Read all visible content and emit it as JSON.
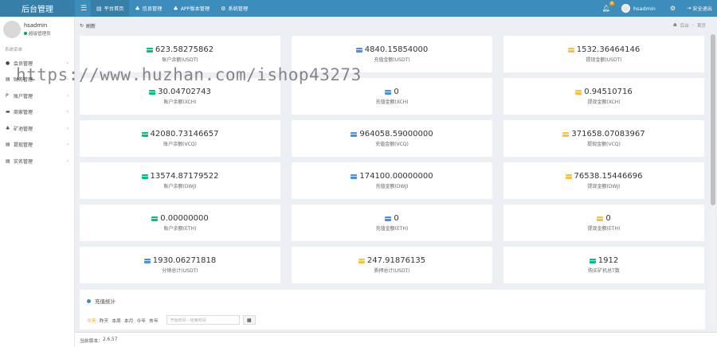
{
  "topbar": {
    "logo": "后台管理",
    "nav": [
      {
        "icon": "▤",
        "label": "平台首页",
        "active": true
      },
      {
        "icon": "♣",
        "label": "信息管理",
        "active": false
      },
      {
        "icon": "♣",
        "label": "APP版本管理",
        "active": false
      },
      {
        "icon": "⚙",
        "label": "系统管理",
        "active": false
      }
    ],
    "badge": "0",
    "username": "hsadmin",
    "logout": "安全退出"
  },
  "sidebar": {
    "username": "hsadmin",
    "role": "超级管理员",
    "header": "系统菜单",
    "items": [
      {
        "icon": "●",
        "label": "会员管理"
      },
      {
        "icon": "▤",
        "label": "财务管理"
      },
      {
        "icon": "P",
        "label": "账户管理"
      },
      {
        "icon": "▬",
        "label": "商家管理"
      },
      {
        "icon": "♣",
        "label": "矿池管理"
      },
      {
        "icon": "▤",
        "label": "提现管理"
      },
      {
        "icon": "▤",
        "label": "实名管理"
      }
    ]
  },
  "content_header": {
    "refresh": "刷新",
    "crumb_root": "后台",
    "crumb_current": "首页"
  },
  "cards": [
    {
      "value": "623.58275862",
      "label": "账户余额(USDT)",
      "color": "#00c27a"
    },
    {
      "value": "4840.15854000",
      "label": "充值金额(USDT)",
      "color": "#4a90e2"
    },
    {
      "value": "1532.36464146",
      "label": "提现金额(USDT)",
      "color": "#f5c242"
    },
    {
      "value": "30.04702743",
      "label": "账户余额(XCH)",
      "color": "#00c27a"
    },
    {
      "value": "0",
      "label": "充值金额(XCH)",
      "color": "#4a90e2"
    },
    {
      "value": "0.94510716",
      "label": "提现金额(XCH)",
      "color": "#f5c242"
    },
    {
      "value": "42080.73146657",
      "label": "账户余额(VCQ)",
      "color": "#00c27a"
    },
    {
      "value": "964058.59000000",
      "label": "充值金额(VCQ)",
      "color": "#4a90e2"
    },
    {
      "value": "371658.07083967",
      "label": "提现金额(VCQ)",
      "color": "#f5c242"
    },
    {
      "value": "13574.87179522",
      "label": "账户余额(DWJ)",
      "color": "#00c27a"
    },
    {
      "value": "174100.00000000",
      "label": "充值金额(DWJ)",
      "color": "#4a90e2"
    },
    {
      "value": "76538.15446696",
      "label": "提现金额(DWJ)",
      "color": "#f5c242"
    },
    {
      "value": "0.00000000",
      "label": "账户余额(ETH)",
      "color": "#00c27a"
    },
    {
      "value": "0",
      "label": "充值金额(ETH)",
      "color": "#4a90e2"
    },
    {
      "value": "0",
      "label": "提现金额(ETH)",
      "color": "#f5c242"
    },
    {
      "value": "1930.06271818",
      "label": "分销总计(USDT)",
      "color": "#4a90e2"
    },
    {
      "value": "247.91876135",
      "label": "质押总计(USDT)",
      "color": "#f5c242"
    },
    {
      "value": "1912",
      "label": "购买矿机总T数",
      "color": "#00c27a"
    }
  ],
  "stats": {
    "title": "充值统计",
    "tabs": [
      "今天",
      "昨天",
      "本周",
      "本月",
      "今年",
      "去年"
    ],
    "range_placeholder": "开始时间 - 结束时间"
  },
  "footer": {
    "version_label": "当前版本：",
    "version": "2.6.57"
  },
  "watermark": "https://www.huzhan.com/ishop43273"
}
